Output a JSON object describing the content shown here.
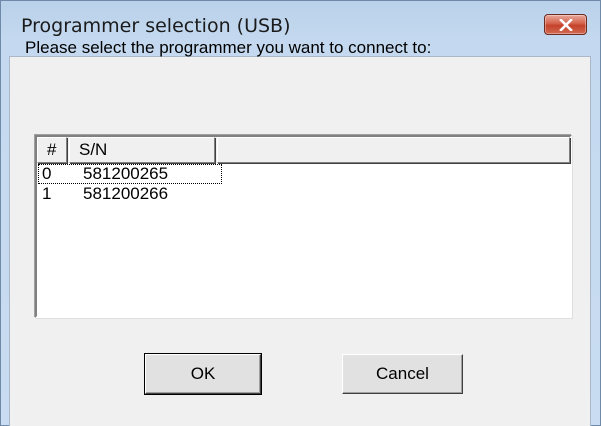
{
  "window": {
    "title": "Programmer selection (USB)"
  },
  "prompt": "Please select the programmer you want to connect to:",
  "list": {
    "columns": [
      "#",
      "S/N",
      ""
    ],
    "rows": [
      {
        "num": "0",
        "sn": "581200265",
        "focused": true
      },
      {
        "num": "1",
        "sn": "581200266",
        "focused": false
      }
    ]
  },
  "buttons": {
    "ok": "OK",
    "cancel": "Cancel"
  },
  "colors": {
    "title_bar": "#c4d9ef",
    "close_button": "#c4412a",
    "dialog_face": "#f0f0f0"
  },
  "icons": {
    "close": "close-icon"
  }
}
